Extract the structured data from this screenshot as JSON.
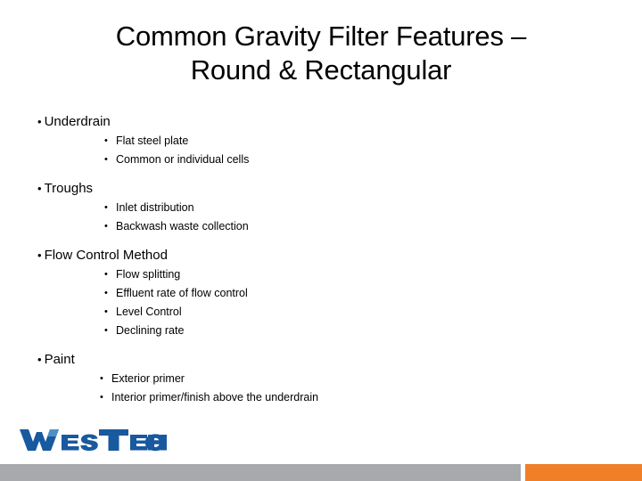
{
  "slide": {
    "title": {
      "line1": "Common Gravity Filter Features –",
      "line2": "Round & Rectangular"
    },
    "bullet_glyph": "•",
    "groups": [
      {
        "label": "Underdrain",
        "items": [
          "Flat steel plate",
          "Common or individual cells"
        ]
      },
      {
        "label": "Troughs",
        "items": [
          "Inlet distribution",
          "Backwash waste collection"
        ]
      },
      {
        "label": "Flow Control Method",
        "items": [
          "Flow splitting",
          "Effluent rate of flow control",
          "Level Control",
          "Declining rate"
        ]
      },
      {
        "label": "Paint",
        "items": [
          "Exterior primer",
          "Interior primer/finish above the underdrain"
        ]
      }
    ]
  },
  "logo": {
    "text_wes": "Wes",
    "text_tech": "Tech",
    "full_text": "WesTech",
    "color_dark": "#18599F",
    "color_light": "#4E8FC6"
  },
  "footer": {
    "bar_gray_color": "#A7A9AC",
    "bar_orange_color": "#F07F28"
  }
}
